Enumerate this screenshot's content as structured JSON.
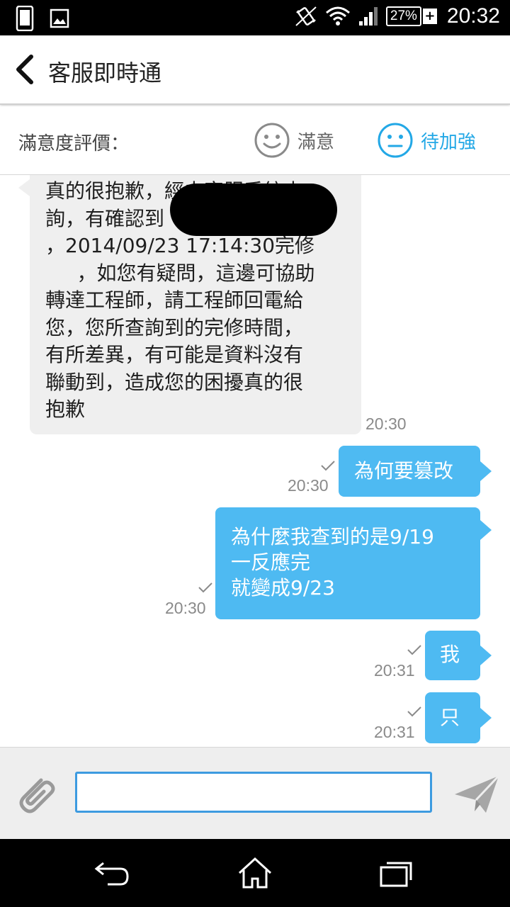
{
  "status_bar": {
    "time": "20:32",
    "battery_percent": "27%",
    "battery_plus": "+",
    "icons": [
      "phone-icon",
      "image-icon",
      "vibrate-icon",
      "wifi-icon",
      "signal-icon",
      "battery-icon"
    ]
  },
  "app_bar": {
    "back_icon": "chevron-left-icon",
    "title": "客服即時通"
  },
  "rating": {
    "label": "滿意度評價：",
    "satisfied": "滿意",
    "needs_improvement": "待加強",
    "selected": "needs_improvement",
    "accent_color": "#23a8e6"
  },
  "messages": [
    {
      "direction": "incoming",
      "text": "真的很抱歉，經由客服系統查\n詢，有確認到\n，2014/09/23 17:14:30完修\n     ，如您有疑問，這邊可協助\n轉達工程師，請工程師回電給\n您，您所查詢到的完修時間，\n有所差異，有可能是資料沒有\n聯動到，造成您的困擾真的很\n抱歉",
      "time": "20:30",
      "redacted": true
    },
    {
      "direction": "outgoing",
      "text": "為何要篡改",
      "time": "20:30",
      "read": true
    },
    {
      "direction": "outgoing",
      "text": "為什麼我查到的是9/19\n一反應完\n就變成9/23",
      "time": "20:30",
      "read": true
    },
    {
      "direction": "outgoing",
      "text": "我",
      "time": "20:31",
      "read": true
    },
    {
      "direction": "outgoing",
      "text": "只",
      "time": "20:31",
      "read": true
    }
  ],
  "composer": {
    "attach_icon": "paperclip-icon",
    "input_value": "",
    "send_icon": "send-icon"
  },
  "colors": {
    "outgoing_bubble": "#4ebaf2",
    "incoming_bubble": "#efefef",
    "input_border": "#3d9be0"
  },
  "nav_bar": [
    "back-icon",
    "home-icon",
    "recents-icon"
  ]
}
